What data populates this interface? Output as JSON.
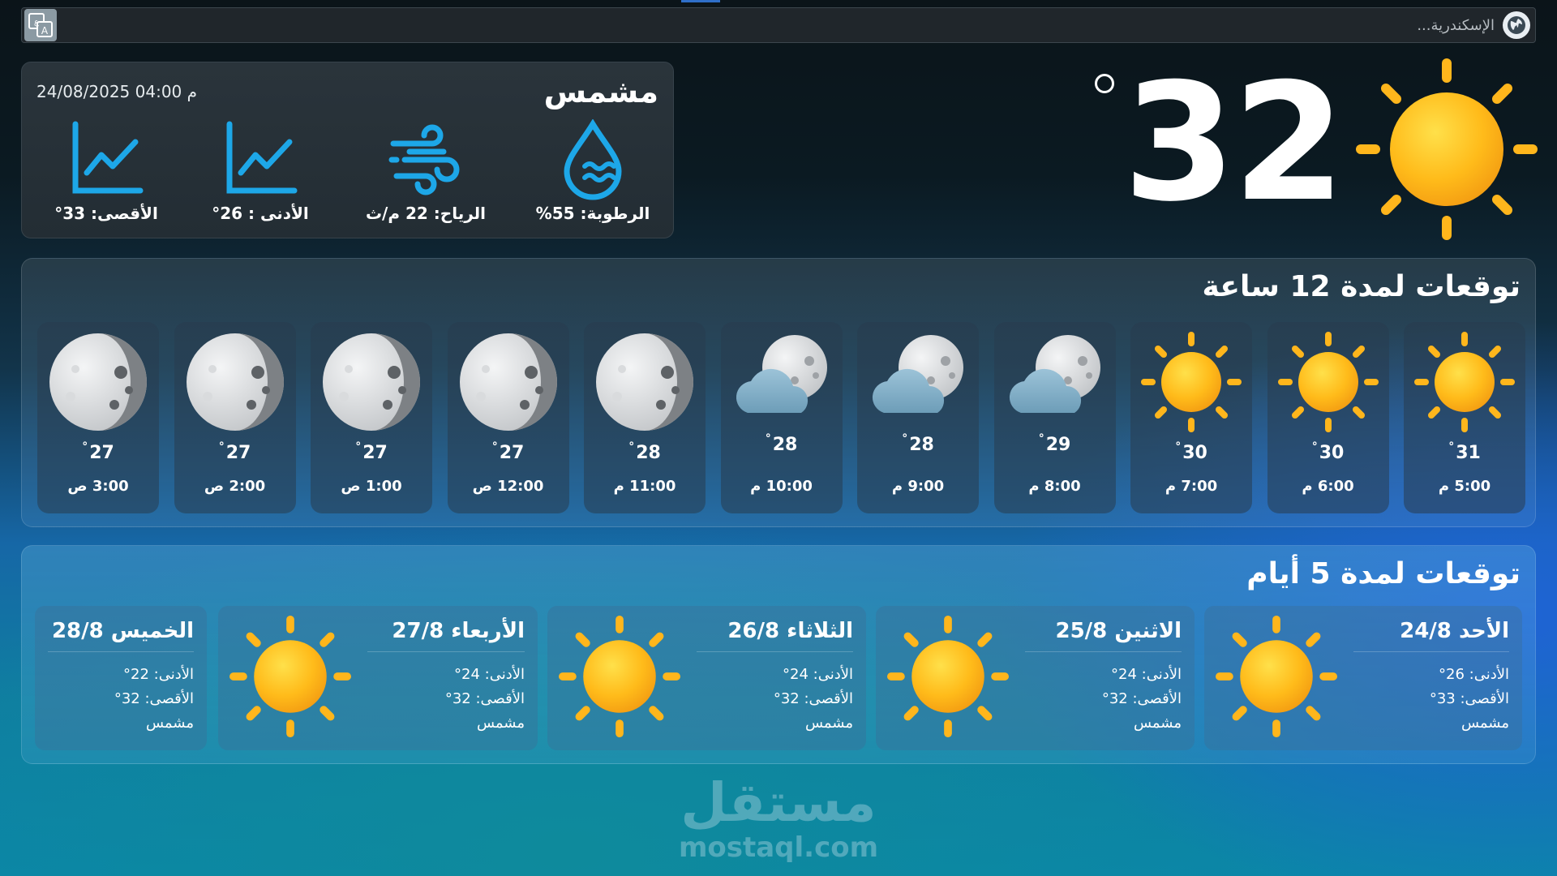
{
  "search": {
    "placeholder": "الإسكندرية..."
  },
  "current": {
    "temp": "32",
    "condition": "مشمس",
    "datetime": "24/08/2025 04:00 م",
    "humidity": "الرطوبة: 55%",
    "wind": "الرياح: 22 م/ث",
    "min": "الأدنى : 26°",
    "max": "الأقصى: 33°"
  },
  "hourly": {
    "title": "توقعات لمدة 12 ساعة",
    "items": [
      {
        "time": "5:00 م",
        "temp": "31",
        "icon": "sun-icon"
      },
      {
        "time": "6:00 م",
        "temp": "30",
        "icon": "sun-icon"
      },
      {
        "time": "7:00 م",
        "temp": "30",
        "icon": "sun-icon"
      },
      {
        "time": "8:00 م",
        "temp": "29",
        "icon": "cloudy-moon-icon"
      },
      {
        "time": "9:00 م",
        "temp": "28",
        "icon": "cloudy-moon-icon"
      },
      {
        "time": "10:00 م",
        "temp": "28",
        "icon": "cloudy-moon-icon"
      },
      {
        "time": "11:00 م",
        "temp": "28",
        "icon": "moon-icon"
      },
      {
        "time": "12:00 ص",
        "temp": "27",
        "icon": "moon-icon"
      },
      {
        "time": "1:00 ص",
        "temp": "27",
        "icon": "moon-icon"
      },
      {
        "time": "2:00 ص",
        "temp": "27",
        "icon": "moon-icon"
      },
      {
        "time": "3:00 ص",
        "temp": "27",
        "icon": "moon-icon"
      }
    ]
  },
  "daily": {
    "title": "توقعات لمدة 5 أيام",
    "items": [
      {
        "name": "الأحد 24/8",
        "min": "الأدنى: 26°",
        "max": "الأقصى: 33°",
        "cond": "مشمس",
        "icon": "sun-icon"
      },
      {
        "name": "الاثنين 25/8",
        "min": "الأدنى: 24°",
        "max": "الأقصى: 32°",
        "cond": "مشمس",
        "icon": "sun-icon"
      },
      {
        "name": "الثلاثاء 26/8",
        "min": "الأدنى: 24°",
        "max": "الأقصى: 32°",
        "cond": "مشمس",
        "icon": "sun-icon"
      },
      {
        "name": "الأربعاء 27/8",
        "min": "الأدنى: 24°",
        "max": "الأقصى: 32°",
        "cond": "مشمس",
        "icon": "sun-icon"
      },
      {
        "name": "الخميس 28/8",
        "min": "الأدنى: 22°",
        "max": "الأقصى: 32°",
        "cond": "مشمس",
        "icon": "sun-icon"
      }
    ]
  },
  "watermark": {
    "ar": "مستقل",
    "en": "mostaql.com"
  },
  "colors": {
    "accent": "#1da7e8",
    "sun": "#ffb21a",
    "moon": "#bfc2c5"
  }
}
